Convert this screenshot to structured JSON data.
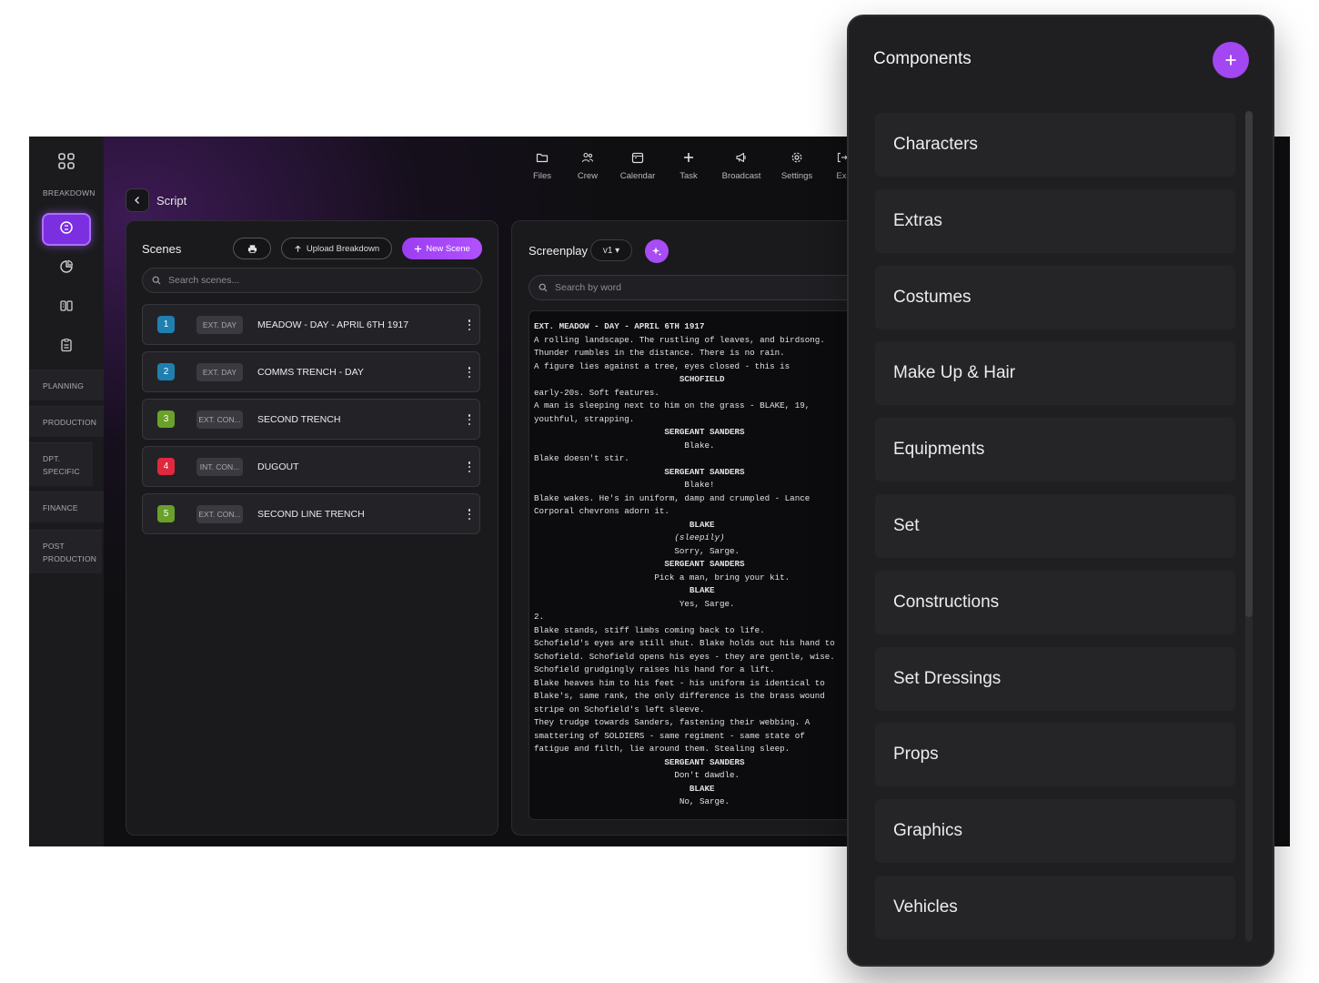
{
  "sidebar": {
    "sections": [
      "BREAKDOWN",
      "PLANNING",
      "PRODUCTION",
      "DPT. SPECIFIC",
      "FINANCE",
      "POST PRODUCTION"
    ],
    "icons": [
      "apps-grid-icon",
      "script-icon",
      "pie-chart-icon",
      "board-icon",
      "clipboard-icon"
    ]
  },
  "breadcrumb": {
    "title": "Script"
  },
  "topnav": [
    {
      "label": "Files",
      "icon": "folder-icon"
    },
    {
      "label": "Crew",
      "icon": "users-icon"
    },
    {
      "label": "Calendar",
      "icon": "calendar-icon"
    },
    {
      "label": "Task",
      "icon": "plus-icon"
    },
    {
      "label": "Broadcast",
      "icon": "megaphone-icon"
    },
    {
      "label": "Settings",
      "icon": "gear-icon"
    },
    {
      "label": "Exi",
      "icon": "exit-icon"
    }
  ],
  "scenes": {
    "title": "Scenes",
    "upload_label": "Upload Breakdown",
    "new_label": "New Scene",
    "search_placeholder": "Search scenes...",
    "rows": [
      {
        "num": "1",
        "tag": "EXT. DAY",
        "name": "MEADOW - DAY - APRIL 6TH 1917",
        "color": "#1f7fb0"
      },
      {
        "num": "2",
        "tag": "EXT. DAY",
        "name": "COMMS TRENCH - DAY",
        "color": "#1f7fb0"
      },
      {
        "num": "3",
        "tag": "EXT. CON...",
        "name": "SECOND TRENCH",
        "color": "#6aa12a"
      },
      {
        "num": "4",
        "tag": "INT. CON...",
        "name": "DUGOUT",
        "color": "#e0283f"
      },
      {
        "num": "5",
        "tag": "EXT. CON...",
        "name": "SECOND LINE TRENCH",
        "color": "#6aa12a"
      }
    ]
  },
  "screenplay": {
    "title": "Screenplay",
    "version": "v1 ▾",
    "search_placeholder": "Search by word",
    "lines": [
      {
        "t": "EXT. MEADOW - DAY - APRIL 6TH 1917",
        "s": "b"
      },
      {
        "t": "A rolling landscape. The rustling of leaves, and birdsong.",
        "s": ""
      },
      {
        "t": "Thunder rumbles in the distance. There is no rain.",
        "s": ""
      },
      {
        "t": "A figure lies against a tree, eyes closed - this is",
        "s": ""
      },
      {
        "t": "                             SCHOFIELD",
        "s": "b"
      },
      {
        "t": "early-20s. Soft features.",
        "s": ""
      },
      {
        "t": "A man is sleeping next to him on the grass - BLAKE, 19,",
        "s": ""
      },
      {
        "t": "youthful, strapping.",
        "s": ""
      },
      {
        "t": "                          SERGEANT SANDERS",
        "s": "b"
      },
      {
        "t": "                              Blake.",
        "s": ""
      },
      {
        "t": "Blake doesn't stir.",
        "s": ""
      },
      {
        "t": "                          SERGEANT SANDERS",
        "s": "b"
      },
      {
        "t": "                              Blake!",
        "s": ""
      },
      {
        "t": "Blake wakes. He's in uniform, damp and crumpled - Lance",
        "s": ""
      },
      {
        "t": "Corporal chevrons adorn it.",
        "s": ""
      },
      {
        "t": "                               BLAKE",
        "s": "b"
      },
      {
        "t": "                            (sleepily)",
        "s": "i"
      },
      {
        "t": "                            Sorry, Sarge.",
        "s": ""
      },
      {
        "t": "                          SERGEANT SANDERS",
        "s": "b"
      },
      {
        "t": "                        Pick a man, bring your kit.",
        "s": ""
      },
      {
        "t": "                               BLAKE",
        "s": "b"
      },
      {
        "t": "                             Yes, Sarge.",
        "s": ""
      },
      {
        "t": "2.",
        "s": ""
      },
      {
        "t": "Blake stands, stiff limbs coming back to life.",
        "s": ""
      },
      {
        "t": "Schofield's eyes are still shut. Blake holds out his hand to",
        "s": ""
      },
      {
        "t": "Schofield. Schofield opens his eyes - they are gentle, wise.",
        "s": ""
      },
      {
        "t": "Schofield grudgingly raises his hand for a lift.",
        "s": ""
      },
      {
        "t": "Blake heaves him to his feet - his uniform is identical to",
        "s": ""
      },
      {
        "t": "Blake's, same rank, the only difference is the brass wound",
        "s": ""
      },
      {
        "t": "stripe on Schofield's left sleeve.",
        "s": ""
      },
      {
        "t": "They trudge towards Sanders, fastening their webbing. A",
        "s": ""
      },
      {
        "t": "smattering of SOLDIERS - same regiment - same state of",
        "s": ""
      },
      {
        "t": "fatigue and filth, lie around them. Stealing sleep.",
        "s": ""
      },
      {
        "t": "                          SERGEANT SANDERS",
        "s": "b"
      },
      {
        "t": "                            Don't dawdle.",
        "s": ""
      },
      {
        "t": "                               BLAKE",
        "s": "b"
      },
      {
        "t": "                             No, Sarge.",
        "s": ""
      }
    ]
  },
  "components": {
    "title": "Components",
    "items": [
      "Characters",
      "Extras",
      "Costumes",
      "Make Up & Hair",
      "Equipments",
      "Set",
      "Constructions",
      "Set Dressings",
      "Props",
      "Graphics",
      "Vehicles"
    ]
  },
  "colors": {
    "accent": "#a347f2",
    "active_sidebar": "#7a2fe0"
  }
}
